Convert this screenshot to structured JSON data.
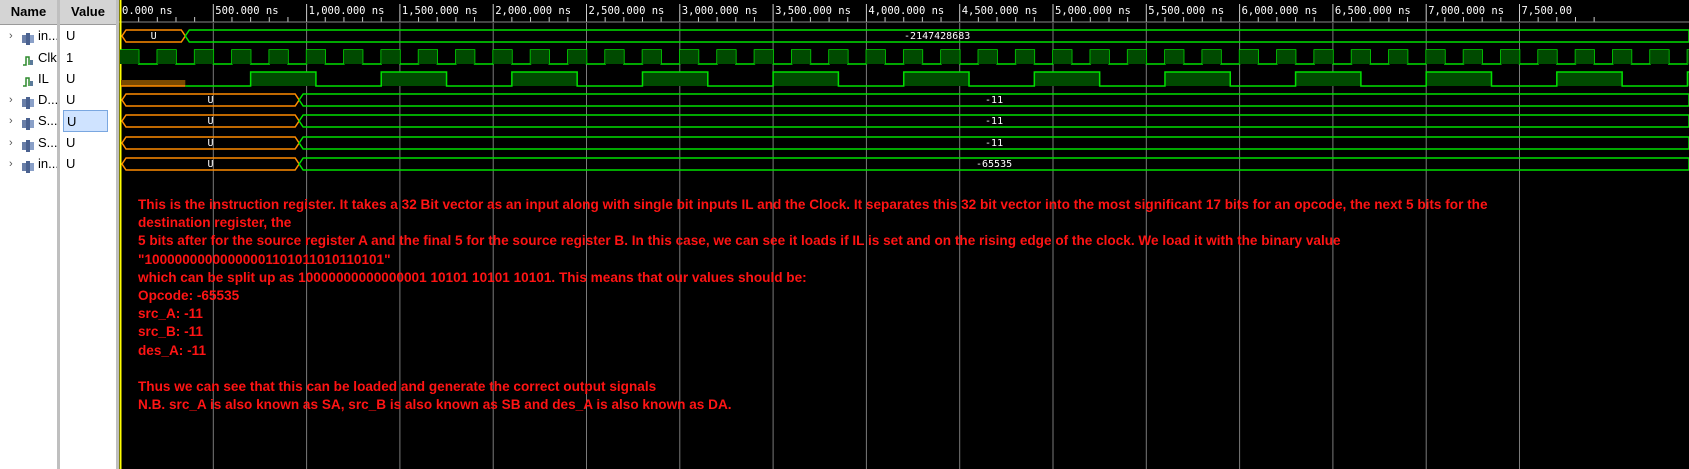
{
  "columns": {
    "name_header": "Name",
    "value_header": "Value"
  },
  "signals": [
    {
      "name": "in...",
      "icon": "bus-icon",
      "expandable": true,
      "value": "U",
      "selected": false
    },
    {
      "name": "Clk",
      "icon": "bit-icon",
      "expandable": false,
      "value": "1",
      "selected": false
    },
    {
      "name": "IL",
      "icon": "bit-icon",
      "expandable": false,
      "value": "U",
      "selected": false
    },
    {
      "name": "D...",
      "icon": "bus-icon",
      "expandable": true,
      "value": "U",
      "selected": false
    },
    {
      "name": "S...",
      "icon": "bus-icon",
      "expandable": true,
      "value": "U",
      "selected": true
    },
    {
      "name": "S...",
      "icon": "bus-icon",
      "expandable": true,
      "value": "U",
      "selected": false
    },
    {
      "name": "in...",
      "icon": "bus-icon",
      "expandable": true,
      "value": "U",
      "selected": false
    }
  ],
  "timeline": {
    "ticks": [
      "0.000 ns",
      "500.000 ns",
      "1,000.000 ns",
      "1,500.000 ns",
      "2,000.000 ns",
      "2,500.000 ns",
      "3,000.000 ns",
      "3,500.000 ns",
      "4,000.000 ns",
      "4,500.000 ns",
      "5,000.000 ns",
      "5,500.000 ns",
      "6,000.000 ns",
      "6,500.000 ns",
      "7,000.000 ns",
      "7,500.00"
    ]
  },
  "waves": {
    "instr_initial": "U",
    "instr_value": "-2147428683",
    "bus_initial": "U",
    "des_value": "-11",
    "src_a_value": "-11",
    "src_b_value": "-11",
    "opcode_value": "-65535"
  },
  "colors": {
    "wave_green": "#00e000",
    "undefined_orange": "#ff8c00",
    "annotation_red": "#ff1414",
    "cursor_yellow": "#ffff00"
  },
  "annotation": [
    "This is the instruction register. It takes a 32 Bit vector as an input along with single bit inputs IL and the Clock. It separates this 32 bit vector into the most significant 17 bits for an opcode, the next 5 bits for the destination register, the",
    "5 bits after for the source register A and the final 5 for the source register B. In this case, we can see it loads if IL is set and on the rising edge of the clock. We load it with the binary value \"10000000000000001101011010110101\"",
    "which can be split up as 10000000000000001 10101 10101 10101. This means that our values should be:",
    "Opcode: -65535",
    "src_A: -11",
    "src_B: -11",
    "des_A: -11",
    "",
    "Thus we can see that this can be loaded and generate the correct output signals",
    "N.B. src_A is also known as SA, src_B is also known as SB and des_A is also known as DA."
  ]
}
